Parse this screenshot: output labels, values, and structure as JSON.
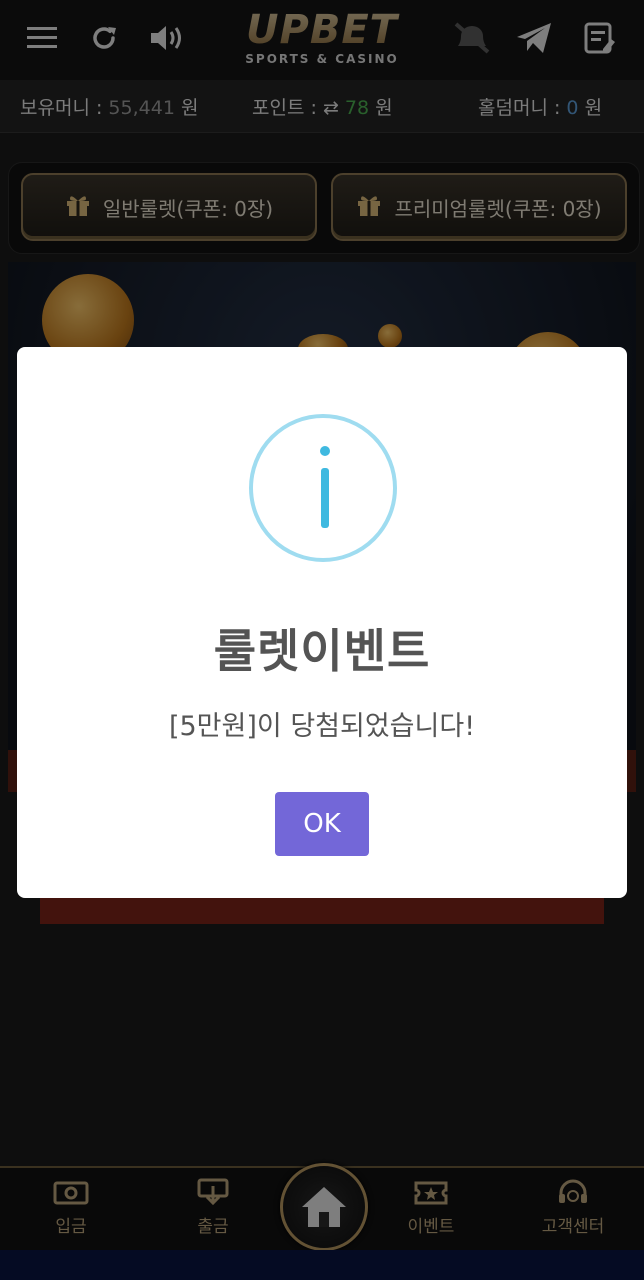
{
  "header": {
    "logo_text": "UPBET",
    "logo_subtitle": "SPORTS & CASINO",
    "icons": [
      "menu-icon",
      "refresh-icon",
      "sound-icon",
      "notification-off-icon",
      "telegram-icon",
      "notes-icon"
    ]
  },
  "balance": {
    "money_label": "보유머니 :",
    "money_value": "55,441",
    "money_unit": "원",
    "point_label": "포인트 :",
    "point_value": "78",
    "point_unit": "원",
    "holdem_label": "홀덤머니 :",
    "holdem_value": "0",
    "holdem_unit": "원"
  },
  "tabs": [
    {
      "label": "일반룰렛(쿠폰: 0장)"
    },
    {
      "label": "프리미엄룰렛(쿠폰: 0장)"
    }
  ],
  "modal": {
    "title": "룰렛이벤트",
    "message": "[5만원]이 당첨되었습니다!",
    "ok_label": "OK"
  },
  "bottom_nav": {
    "items": [
      {
        "label": "입금"
      },
      {
        "label": "출금"
      },
      {
        "label": "이벤트"
      },
      {
        "label": "고객센터"
      }
    ]
  },
  "colors": {
    "accent_gold": "#b49560",
    "ok_button": "#7367d8",
    "info_icon": "#3fb9e0"
  }
}
